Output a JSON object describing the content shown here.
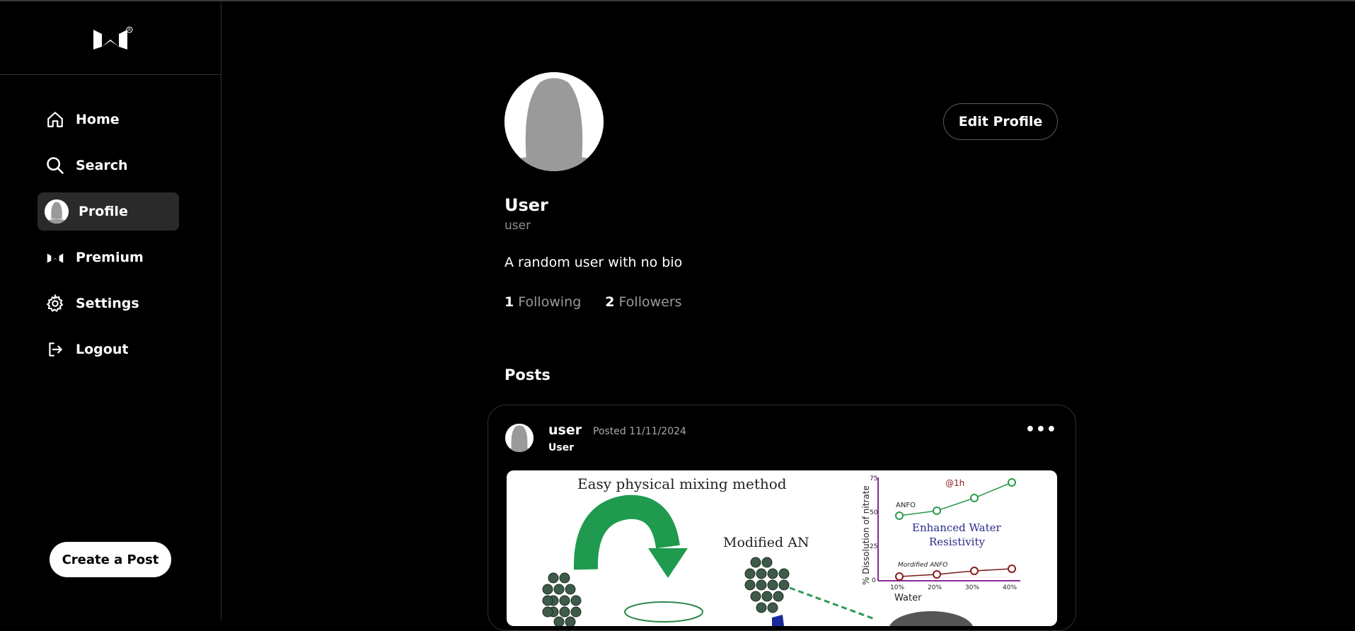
{
  "sidebar": {
    "logo_icon": "brand-bowtie-logo",
    "items": [
      {
        "label": "Home",
        "icon": "home-icon"
      },
      {
        "label": "Search",
        "icon": "search-icon"
      },
      {
        "label": "Profile",
        "icon": "avatar"
      },
      {
        "label": "Premium",
        "icon": "brand-bowtie-logo"
      },
      {
        "label": "Settings",
        "icon": "gear-icon"
      },
      {
        "label": "Logout",
        "icon": "logout-icon"
      }
    ],
    "active_item": "Profile",
    "create_post_label": "Create a Post"
  },
  "profile": {
    "display_name": "User",
    "handle": "user",
    "bio": "A random user with no bio",
    "following_count": "1",
    "following_label": "Following",
    "followers_count": "2",
    "followers_label": "Followers",
    "edit_label": "Edit Profile",
    "posts_heading": "Posts"
  },
  "post": {
    "username": "user",
    "display_name": "User",
    "date": "Posted 11/11/2024",
    "more": "•••",
    "figure": {
      "title": "Easy physical mixing method",
      "modified_label": "Modified AN",
      "chart_note": "@1h",
      "annotation": [
        "Enhanced Water",
        "Resistivity"
      ],
      "ylabel": "% Dissolution of nitrate",
      "xlabel": "Water",
      "yticks": [
        "0",
        "25",
        "50",
        "75"
      ],
      "xticks": [
        "10%",
        "20%",
        "30%",
        "40%"
      ],
      "series_labels": [
        "ANFO",
        "Mordified ANFO"
      ]
    }
  },
  "colors": {
    "background": "#000000",
    "active_nav": "#2a2a2a",
    "muted_text": "#8f8f8f",
    "border": "#2f2f2f"
  }
}
